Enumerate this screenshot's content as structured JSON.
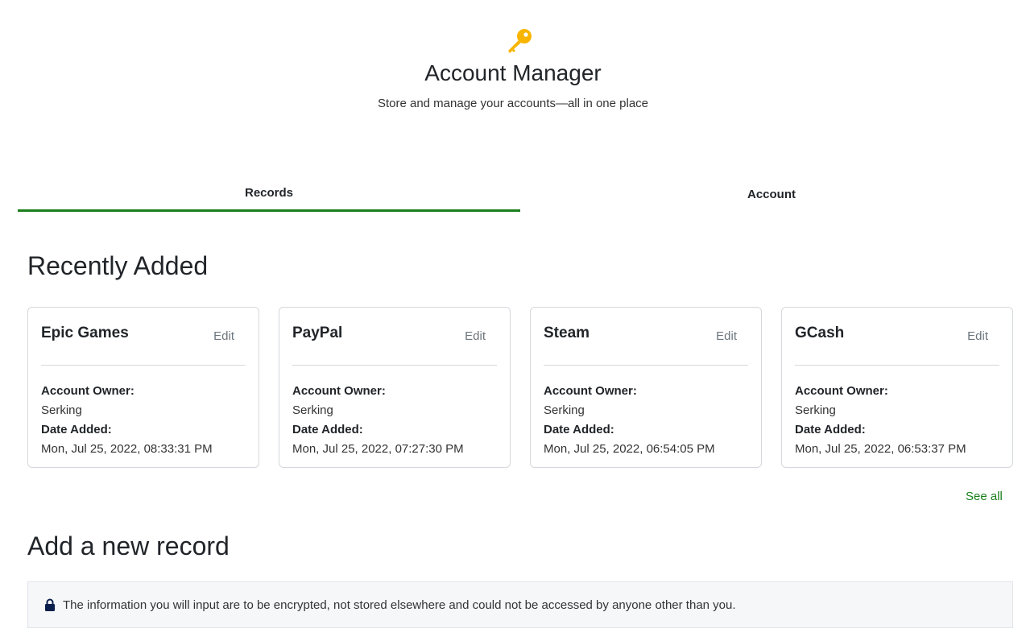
{
  "header": {
    "icon": "key-icon",
    "icon_color": "#f7b500",
    "title": "Account Manager",
    "subtitle": "Store and manage your accounts—all in one place"
  },
  "tabs": [
    {
      "label": "Records",
      "active": true
    },
    {
      "label": "Account",
      "active": false
    }
  ],
  "accent_color": "#1a7f1a",
  "recent": {
    "title": "Recently Added",
    "owner_label": "Account Owner:",
    "date_label": "Date Added:",
    "edit_label": "Edit",
    "cards": [
      {
        "name": "Epic Games",
        "owner": "Serking",
        "date": "Mon, Jul 25, 2022, 08:33:31 PM"
      },
      {
        "name": "PayPal",
        "owner": "Serking",
        "date": "Mon, Jul 25, 2022, 07:27:30 PM"
      },
      {
        "name": "Steam",
        "owner": "Serking",
        "date": "Mon, Jul 25, 2022, 06:54:05 PM"
      },
      {
        "name": "GCash",
        "owner": "Serking",
        "date": "Mon, Jul 25, 2022, 06:53:37 PM"
      }
    ],
    "see_all_label": "See all"
  },
  "add_record": {
    "title": "Add a new record",
    "notice_icon": "lock-icon",
    "notice": "The information you will input are to be encrypted, not stored elsewhere and could not be accessed by anyone other than you."
  }
}
